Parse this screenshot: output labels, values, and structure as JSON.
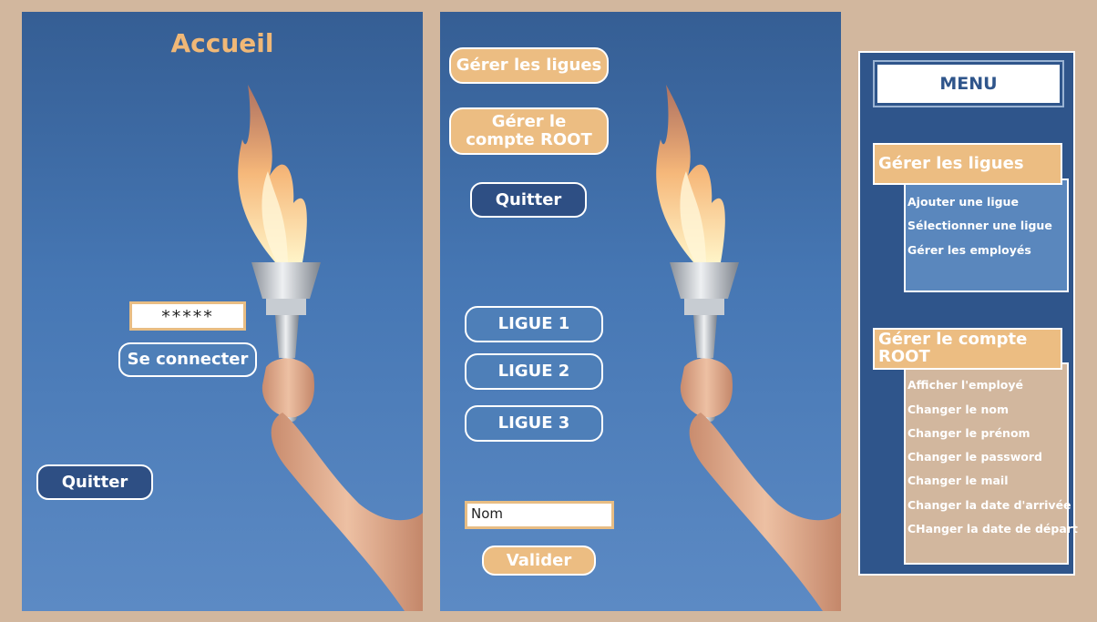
{
  "login": {
    "title": "Accueil",
    "password_value": "*****",
    "connect_label": "Se connecter",
    "quit_label": "Quitter"
  },
  "admin": {
    "manage_leagues_label": "Gérer les ligues",
    "manage_root_label": "Gérer le compte ROOT",
    "quit_label": "Quitter",
    "leagues": [
      "LIGUE 1",
      "LIGUE 2",
      "LIGUE 3"
    ],
    "name_value": "Nom",
    "validate_label": "Valider"
  },
  "menu": {
    "title": "MENU",
    "categories": [
      {
        "label": "Gérer les ligues",
        "items": [
          "Ajouter une ligue",
          "Sélectionner une ligue",
          "Gérer les employés"
        ]
      },
      {
        "label": "Gérer le compte ROOT",
        "items": [
          "Afficher l'employé",
          "Changer le nom",
          "Changer le prénom",
          "Changer le password",
          "Changer le mail",
          "Changer la date d'arrivée",
          "CHanger la date de départ"
        ]
      }
    ]
  },
  "colors": {
    "background": "#d2b79e",
    "panel_blue": "#3f6ba6",
    "accent_orange": "#ecbd82",
    "navy": "#2e4f84",
    "title_orange": "#f0b877"
  },
  "icons": {
    "torch": "olympic-torch-illustration"
  }
}
